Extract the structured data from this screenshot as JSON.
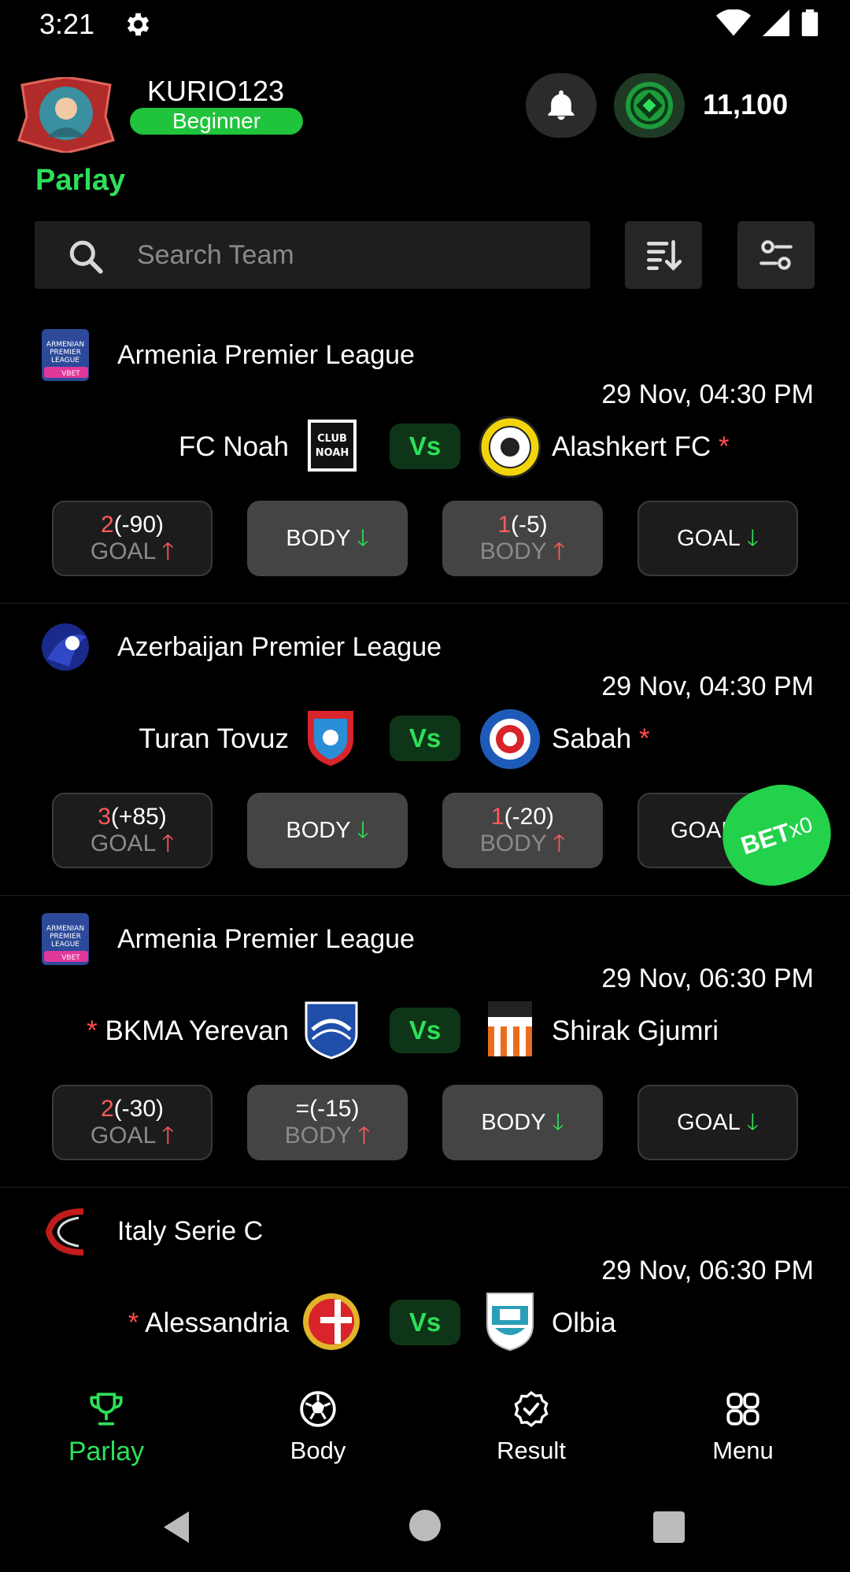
{
  "status_bar": {
    "time": "3:21"
  },
  "header": {
    "username": "KURIO123",
    "rank": "Beginner",
    "coins": "11,100",
    "title": "Parlay"
  },
  "search": {
    "placeholder": "Search Team"
  },
  "matches": [
    {
      "league": "Armenia Premier League",
      "kickoff": "29 Nov, 04:30 PM",
      "home": {
        "name": "FC Noah",
        "favourite": false
      },
      "away": {
        "name": "Alashkert FC",
        "favourite": true
      },
      "vs": "Vs",
      "odds": [
        {
          "num": "2",
          "val": "(-90)",
          "label": "GOAL"
        },
        {
          "label": "BODY"
        },
        {
          "num": "1",
          "val": "(-5)",
          "label": "BODY"
        },
        {
          "label": "GOAL"
        }
      ]
    },
    {
      "league": "Azerbaijan Premier League",
      "kickoff": "29 Nov, 04:30 PM",
      "home": {
        "name": "Turan Tovuz",
        "favourite": false
      },
      "away": {
        "name": "Sabah",
        "favourite": true
      },
      "vs": "Vs",
      "odds": [
        {
          "num": "3",
          "val": "(+85)",
          "label": "GOAL"
        },
        {
          "label": "BODY"
        },
        {
          "num": "1",
          "val": "(-20)",
          "label": "BODY"
        },
        {
          "label": "GOAL"
        }
      ]
    },
    {
      "league": "Armenia Premier League",
      "kickoff": "29 Nov, 06:30 PM",
      "home": {
        "name": "BKMA Yerevan",
        "favourite": true
      },
      "away": {
        "name": "Shirak Gjumri",
        "favourite": false
      },
      "vs": "Vs",
      "odds": [
        {
          "num": "2",
          "val": "(-30)",
          "label": "GOAL"
        },
        {
          "num": "=",
          "val": "(-15)",
          "label": "BODY"
        },
        {
          "label": "BODY"
        },
        {
          "label": "GOAL"
        }
      ]
    },
    {
      "league": "Italy Serie C",
      "kickoff": "29 Nov, 06:30 PM",
      "home": {
        "name": "Alessandria",
        "favourite": true
      },
      "away": {
        "name": "Olbia",
        "favourite": false
      },
      "vs": "Vs"
    }
  ],
  "bet_fab": {
    "label": "BET",
    "count": "x0"
  },
  "bottom_nav": [
    {
      "label": "Parlay",
      "icon": "trophy-icon"
    },
    {
      "label": "Body",
      "icon": "soccer-ball-icon"
    },
    {
      "label": "Result",
      "icon": "check-badge-icon"
    },
    {
      "label": "Menu",
      "icon": "grid-icon"
    }
  ],
  "colors": {
    "accent": "#2de05a",
    "danger": "#ff5a5a",
    "background": "#000000"
  }
}
